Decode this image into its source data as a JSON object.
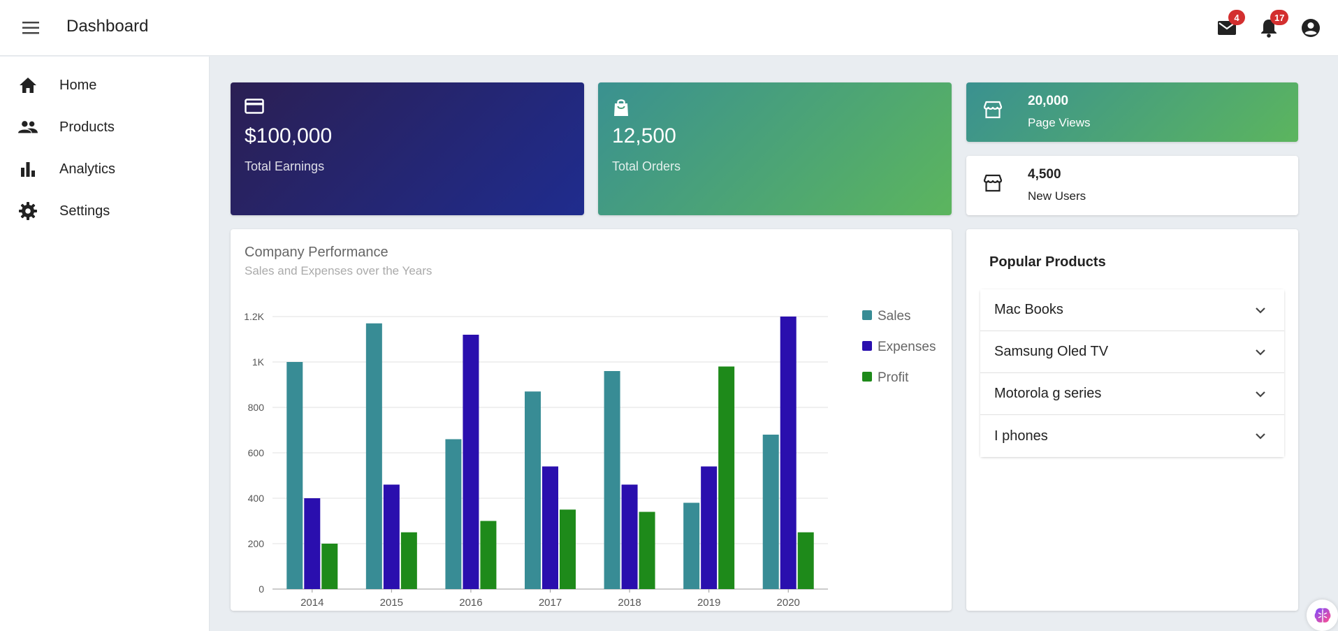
{
  "header": {
    "title": "Dashboard",
    "mail_count": "4",
    "notification_count": "17"
  },
  "sidebar": {
    "items": [
      {
        "label": "Home",
        "icon": "home-icon"
      },
      {
        "label": "Products",
        "icon": "people-icon"
      },
      {
        "label": "Analytics",
        "icon": "bar-chart-icon"
      },
      {
        "label": "Settings",
        "icon": "gear-icon"
      }
    ]
  },
  "stats": {
    "earnings": {
      "value": "$100,000",
      "label": "Total Earnings",
      "icon": "credit-card-icon"
    },
    "orders": {
      "value": "12,500",
      "label": "Total Orders",
      "icon": "shopping-bag-icon"
    },
    "page_views": {
      "value": "20,000",
      "label": "Page Views",
      "icon": "store-icon"
    },
    "new_users": {
      "value": "4,500",
      "label": "New Users",
      "icon": "store-icon"
    }
  },
  "chart": {
    "title": "Company Performance",
    "subtitle": "Sales and Expenses over the Years"
  },
  "chart_data": {
    "type": "bar",
    "categories": [
      "2014",
      "2015",
      "2016",
      "2017",
      "2018",
      "2019",
      "2020"
    ],
    "series": [
      {
        "name": "Sales",
        "color": "#388c95",
        "values": [
          1000,
          1170,
          660,
          870,
          960,
          380,
          680
        ]
      },
      {
        "name": "Expenses",
        "color": "#2a0fae",
        "values": [
          400,
          460,
          1120,
          540,
          460,
          540,
          1200
        ]
      },
      {
        "name": "Profit",
        "color": "#1e8a1a",
        "values": [
          200,
          250,
          300,
          350,
          340,
          980,
          250
        ]
      }
    ],
    "ylim": [
      0,
      1200
    ],
    "yticks": [
      {
        "value": 0,
        "label": "0"
      },
      {
        "value": 200,
        "label": "200"
      },
      {
        "value": 400,
        "label": "400"
      },
      {
        "value": 600,
        "label": "600"
      },
      {
        "value": 800,
        "label": "800"
      },
      {
        "value": 1000,
        "label": "1K"
      },
      {
        "value": 1200,
        "label": "1.2K"
      }
    ],
    "grid": true,
    "legend_position": "right"
  },
  "popular_products": {
    "title": "Popular Products",
    "items": [
      "Mac Books",
      "Samsung Oled TV",
      "Motorola g series",
      "I phones"
    ]
  },
  "colors": {
    "earnings_gradient": [
      "#2b1f53",
      "#1f2c8e"
    ],
    "orders_gradient": [
      "#3a9190",
      "#5cb55e"
    ],
    "page_views_gradient": [
      "#3a9190",
      "#5cb55e"
    ]
  }
}
